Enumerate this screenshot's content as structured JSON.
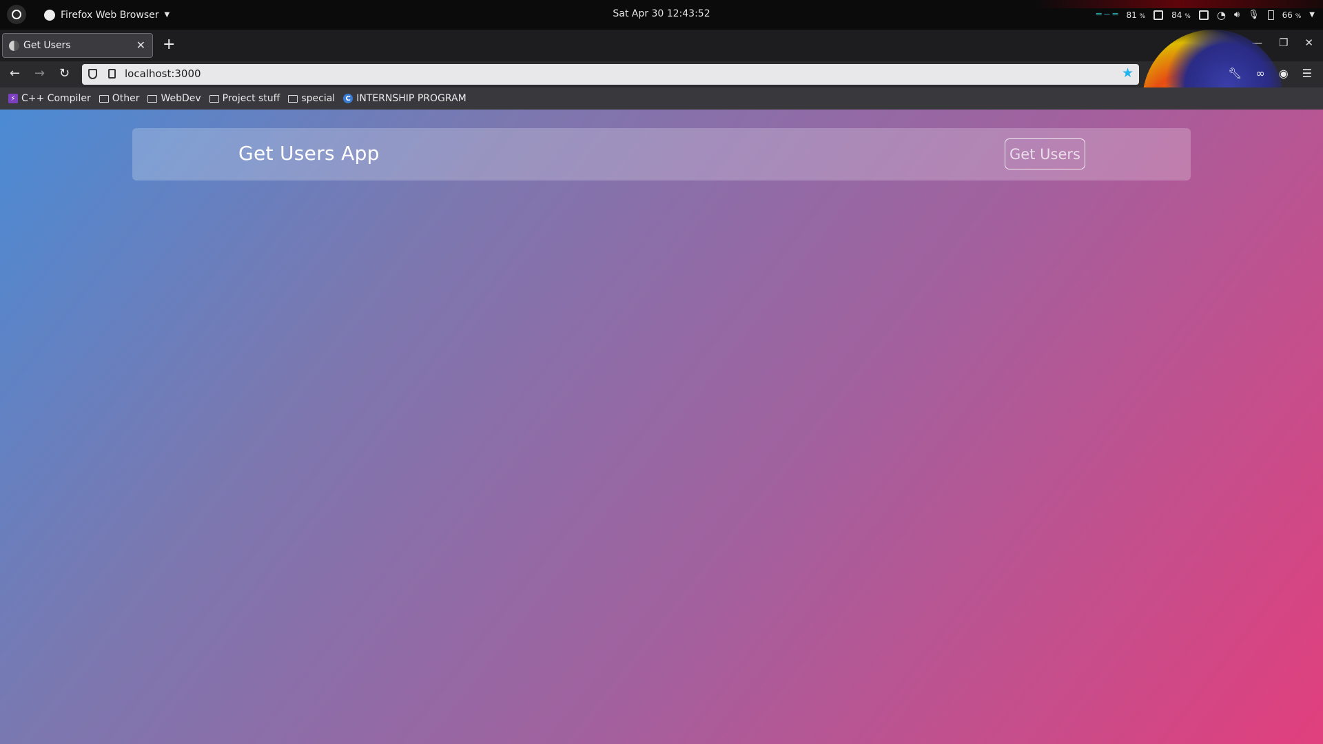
{
  "system_bar": {
    "app_name": "Firefox Web Browser",
    "clock": "Sat Apr 30  12:43:52",
    "stat1": "81",
    "stat2": "84",
    "battery": "66",
    "percent_sign": "%"
  },
  "browser": {
    "tab_title": "Get Users",
    "url": "localhost:3000",
    "bookmarks": [
      {
        "label": "C++ Compiler",
        "icon": "cpp-compiler-icon"
      },
      {
        "label": "Other",
        "icon": "folder-icon"
      },
      {
        "label": "WebDev",
        "icon": "folder-icon"
      },
      {
        "label": "Project stuff",
        "icon": "folder-icon"
      },
      {
        "label": "special",
        "icon": "folder-icon"
      },
      {
        "label": "INTERNSHIP PROGRAM",
        "icon": "internship-icon"
      }
    ],
    "accent_star": "#1fb4f0"
  },
  "page": {
    "title": "Get Users App",
    "button_label": "Get Users",
    "gradient_start": "#4b8bd4",
    "gradient_end": "#e13f7d"
  }
}
